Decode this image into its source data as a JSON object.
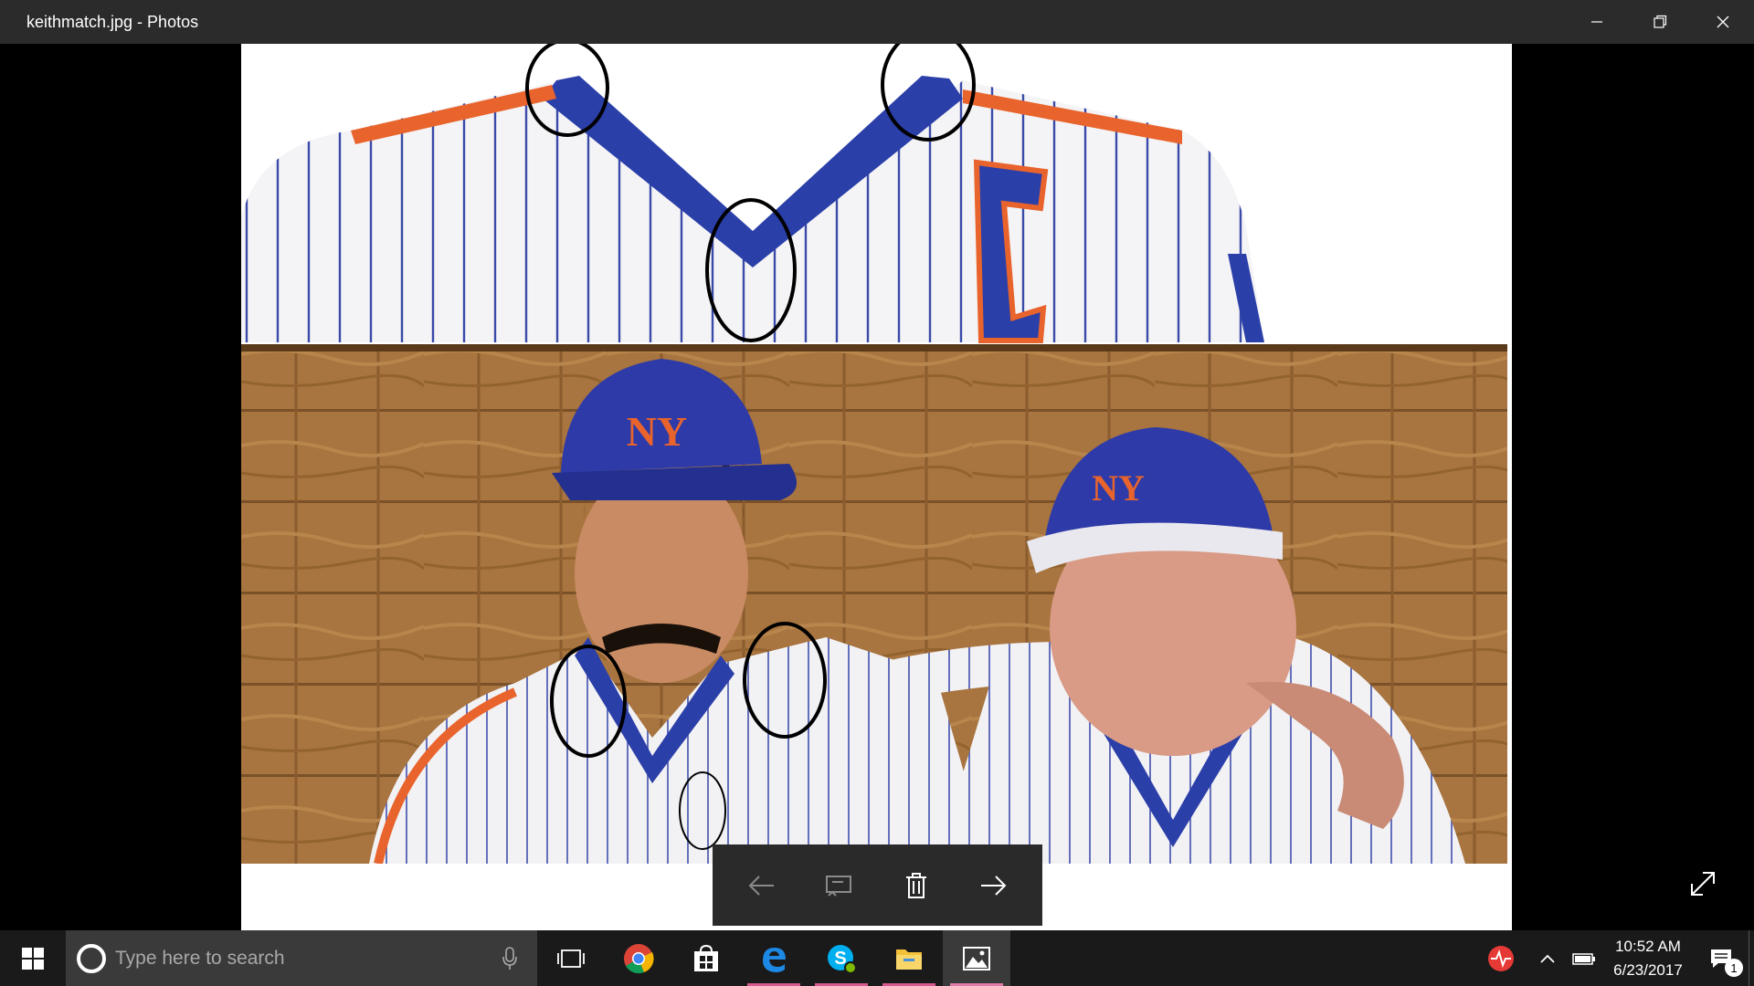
{
  "window": {
    "title": "keithmatch.jpg - Photos"
  },
  "toolbar": {
    "buttons": [
      {
        "name": "previous",
        "icon": "arrow-left-icon"
      },
      {
        "name": "slideshow",
        "icon": "slideshow-icon"
      },
      {
        "name": "delete",
        "icon": "trash-icon"
      },
      {
        "name": "next",
        "icon": "arrow-right-icon"
      }
    ]
  },
  "taskbar": {
    "search_placeholder": "Type here to search",
    "apps": [
      "task-view-icon",
      "chrome-icon",
      "store-icon",
      "edge-icon",
      "skype-icon",
      "file-explorer-icon",
      "photos-icon"
    ],
    "clock": {
      "time": "10:52 AM",
      "date": "6/23/2017"
    },
    "notification_count": "1"
  },
  "colors": {
    "titlebar": "#2b2b2b",
    "taskbar": "#1a1a1a",
    "mets_blue": "#2b3fa8",
    "mets_orange": "#e8642c",
    "wood": "#a8743f"
  }
}
